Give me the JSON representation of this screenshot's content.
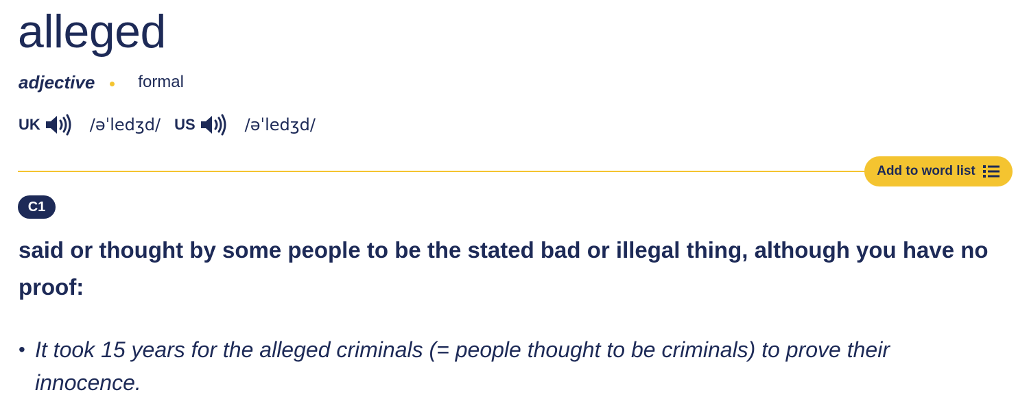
{
  "entry": {
    "headword": "alleged",
    "part_of_speech": "adjective",
    "register": "formal"
  },
  "pronunciation": {
    "uk_label": "UK",
    "uk_ipa": "/əˈledʒd/",
    "us_label": "US",
    "us_ipa": "/əˈledʒd/",
    "icons": [
      "speaker-icon"
    ]
  },
  "actions": {
    "add_to_word_list": "Add to word list"
  },
  "sense": {
    "level": "C1",
    "definition": "said or thought by some people to be the stated bad or illegal thing, although you have no proof:",
    "examples": [
      "It took 15 years for the alleged criminals (= people thought to be criminals) to prove their innocence."
    ]
  },
  "colors": {
    "text": "#1d2a57",
    "accent": "#f4c430",
    "level_badge": "#1d2a57"
  }
}
